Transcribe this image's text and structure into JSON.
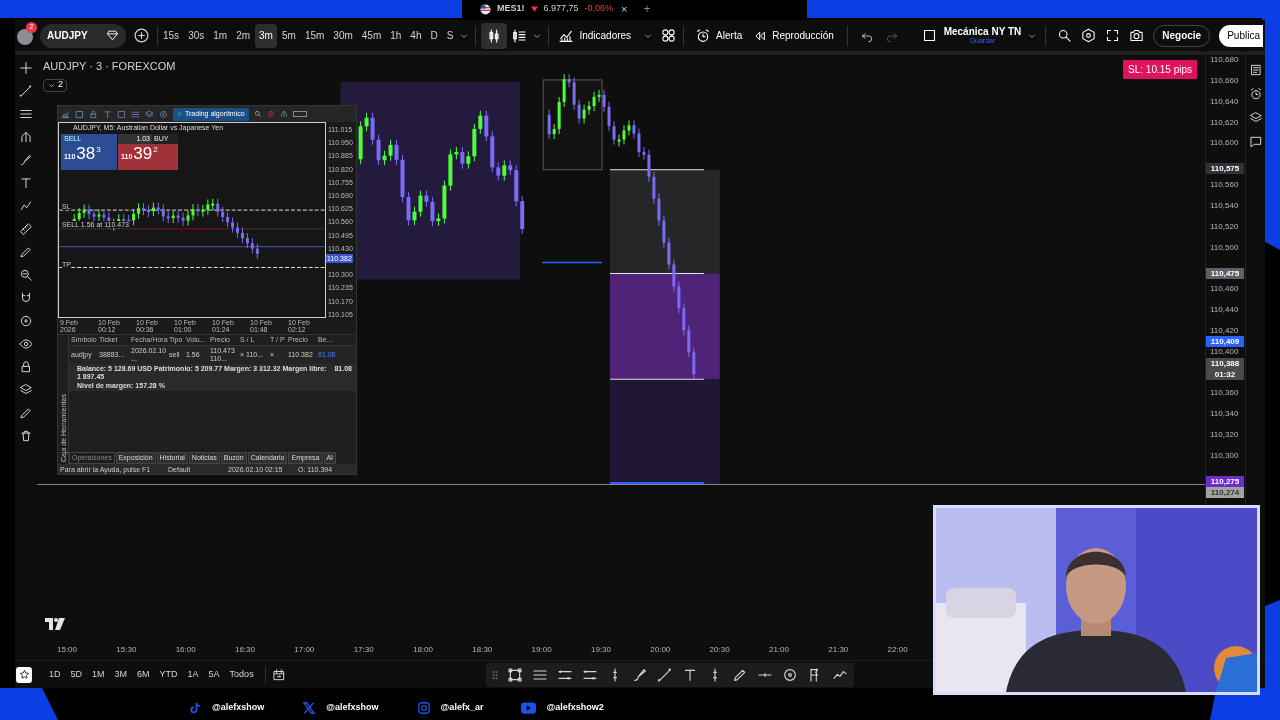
{
  "browser_tab": {
    "symbol": "MES1!",
    "price": "6.977,75",
    "change": "-0,06%",
    "close": "×",
    "new_tab": "+"
  },
  "toolbar": {
    "badge": "2",
    "symbol": "AUDJPY",
    "intervals": [
      {
        "label": "15s",
        "selected": false
      },
      {
        "label": "30s",
        "selected": false
      },
      {
        "label": "1m",
        "selected": false
      },
      {
        "label": "2m",
        "selected": false
      },
      {
        "label": "3m",
        "selected": true
      },
      {
        "label": "5m",
        "selected": false
      },
      {
        "label": "15m",
        "selected": false
      },
      {
        "label": "30m",
        "selected": false
      },
      {
        "label": "45m",
        "selected": false
      },
      {
        "label": "1h",
        "selected": false
      },
      {
        "label": "4h",
        "selected": false
      },
      {
        "label": "D",
        "selected": false
      },
      {
        "label": "S",
        "selected": false
      }
    ],
    "candles_selected": true,
    "indicators": "Indicadores",
    "alert": "Alerta",
    "replay": "Reproducción",
    "layout": {
      "name": "Mecánica NY TN",
      "action": "Guardar"
    },
    "trade": "Negocie",
    "publish": "Publica"
  },
  "chart": {
    "title": "AUDJPY · 3 · FOREXCOM",
    "panes_toggle": "2",
    "sl_badge": "SL: 10.15 pips",
    "price_scale": [
      "110,680",
      "110,660",
      "110,640",
      "110,620",
      "110,600",
      "110,560",
      "110,540",
      "110,520",
      "110,500",
      "110,460",
      "110,440",
      "110,420",
      "110,400",
      "110,360",
      "110,340",
      "110,320",
      "110,300"
    ],
    "price_markers": [
      {
        "value": "110,575",
        "color": "#2f3237"
      },
      {
        "value": "110,475",
        "color": "#5d6068"
      },
      {
        "value": "110,409",
        "color": "#2962ff"
      },
      {
        "value": "110,388",
        "countdown": "01:32",
        "color": "#4a4a4a"
      },
      {
        "value": "110,275",
        "color": "#6b2fc9"
      },
      {
        "value": "110,274",
        "color": "#a3a3a3"
      }
    ],
    "time_scale": [
      "15:00",
      "15:30",
      "16:00",
      "16:30",
      "17:00",
      "17:30",
      "18:00",
      "18:30",
      "19:00",
      "19:30",
      "20:00",
      "20:30",
      "21:00",
      "21:30",
      "22:00"
    ]
  },
  "range_buttons": [
    "1D",
    "5D",
    "1M",
    "3M",
    "6M",
    "YTD",
    "1A",
    "5A",
    "Todos"
  ],
  "mt_window": {
    "toolbar_button": "Trading algorítmico",
    "chart_title": "AUDJPY, M5: Australian Dollar vs Japanese Yen",
    "sell_label": "SELL",
    "lot": "1.03",
    "buy_label": "BUY",
    "bid": {
      "prefix": "110",
      "main": "38",
      "sup": "3"
    },
    "ask": {
      "prefix": "110",
      "main": "39",
      "sup": "2"
    },
    "price_scale": [
      "111.015",
      "110.950",
      "110.885",
      "110.820",
      "110.755",
      "110.690",
      "110.625",
      "110.560",
      "110.495",
      "110.430",
      "110.300",
      "110.235",
      "110.170",
      "110.105"
    ],
    "current_price": "110.382",
    "lines": [
      {
        "kind": "sl",
        "label": "SL"
      },
      {
        "kind": "entry",
        "label": "SELL 1.56 at 110.473"
      },
      {
        "kind": "tp",
        "label": "TP"
      }
    ],
    "time_scale": [
      "9 Feb 2026",
      "10 Feb 00:12",
      "10 Feb 00:36",
      "10 Feb 01:00",
      "10 Feb 01:24",
      "10 Feb 01:48",
      "10 Feb 02:12"
    ],
    "table": {
      "columns": [
        "Símbolo",
        "Ticket",
        "Fecha/Hora",
        "Tipo",
        "Volu...",
        "Precio",
        "S / L",
        "T / P",
        "Precio",
        "Be..."
      ],
      "row": [
        "audjpy",
        "38883...",
        "2026.02.10 ...",
        "sell",
        "1.56",
        "110.473 110...",
        "× 110...",
        "×",
        "110.382",
        "81.08"
      ],
      "balance": "Balance: 5 128.69 USD  Patrimonio: 5 209.77  Margen: 3 312.32  Margen libre: 1 897.45",
      "balance_profit": "81.08",
      "margin_level": "Nivel de margen: 157.28 %"
    },
    "tabs": [
      {
        "label": "Operaciones",
        "selected": true
      },
      {
        "label": "Exposición",
        "selected": false
      },
      {
        "label": "Historial",
        "selected": false
      },
      {
        "label": "Noticias",
        "selected": false
      },
      {
        "label": "Buzón",
        "selected": false
      },
      {
        "label": "Calendario",
        "selected": false
      },
      {
        "label": "Empresa",
        "selected": false
      },
      {
        "label": "Al",
        "selected": false
      }
    ],
    "side_label": "Caja de Herramientas",
    "status": [
      "Para abrir la Ayuda, pulse F1",
      "Default",
      "2026.02.10 02:15",
      "O: 110.394"
    ]
  },
  "socials": [
    {
      "kind": "tiktok",
      "handle": "@alefxshow"
    },
    {
      "kind": "x",
      "handle": "@alefxshow"
    },
    {
      "kind": "instagram",
      "handle": "@alefx_ar"
    },
    {
      "kind": "youtube",
      "handle": "@alefxshow2"
    }
  ]
}
